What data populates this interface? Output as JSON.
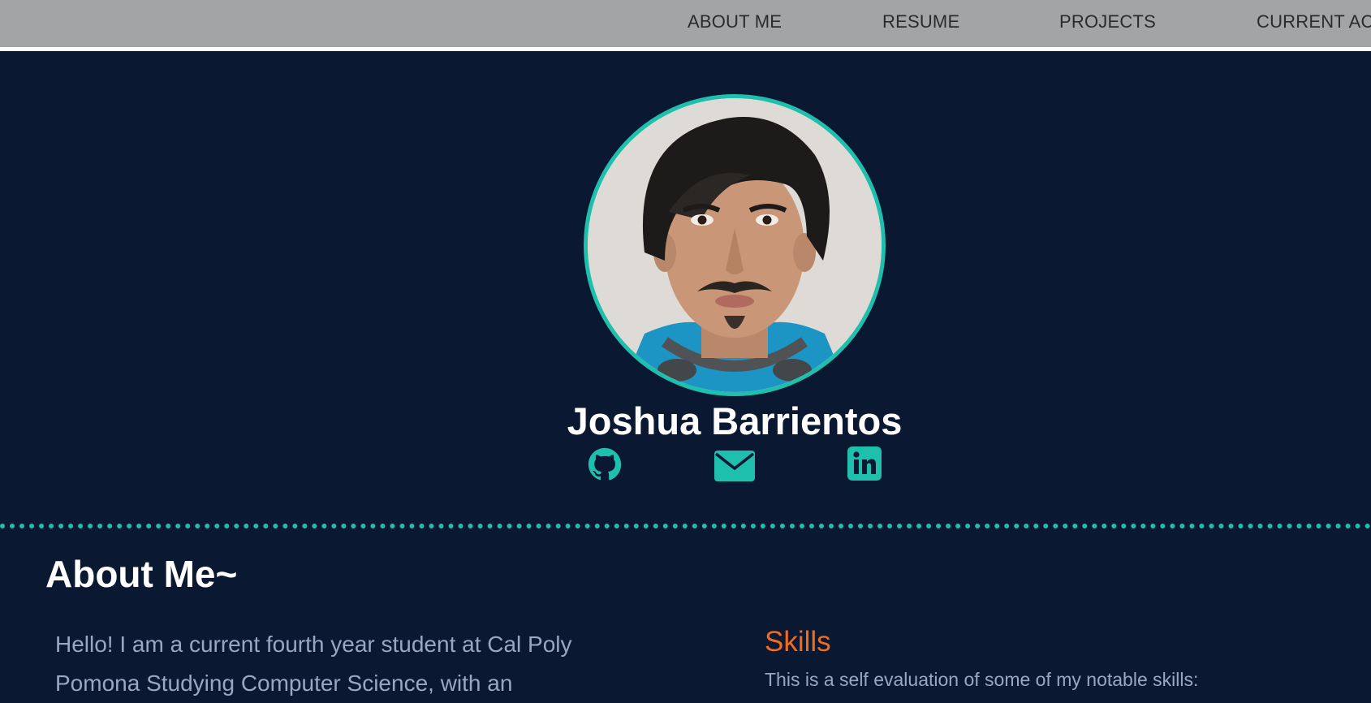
{
  "nav": {
    "items": [
      {
        "label": "ABOUT ME"
      },
      {
        "label": "RESUME"
      },
      {
        "label": "PROJECTS"
      },
      {
        "label": "CURRENT ACTIVITIES"
      }
    ]
  },
  "profile": {
    "name": "Joshua Barrientos",
    "social": [
      {
        "icon": "github-icon"
      },
      {
        "icon": "email-icon"
      },
      {
        "icon": "linkedin-icon"
      }
    ]
  },
  "about": {
    "heading": "About Me~",
    "text": "Hello! I am a current fourth year student at Cal Poly Pomona Studying Computer Science, with an"
  },
  "skills": {
    "heading": "Skills",
    "description": "This is a self evaluation of some of my notable skills:"
  },
  "colors": {
    "background": "#0a1931",
    "navbar": "#a3a4a6",
    "accent": "#1fbfad",
    "skills_heading": "#f26b1d",
    "body_text": "#9aa6c3"
  }
}
